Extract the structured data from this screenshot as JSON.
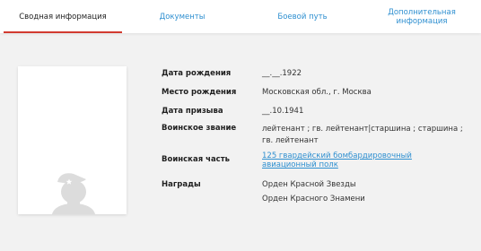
{
  "tabs": [
    {
      "label": "Сводная информация",
      "active": true
    },
    {
      "label": "Документы",
      "active": false
    },
    {
      "label": "Боевой путь",
      "active": false
    },
    {
      "label": "Дополнительная информация",
      "active": false
    }
  ],
  "colors": {
    "accent_red": "#d23b30",
    "link_blue": "#2e8fd0",
    "background": "#f2f2f2",
    "avatar_gray": "#dcdcdc"
  },
  "icons": {
    "avatar": "soldier-silhouette-icon"
  },
  "profile": {
    "birth_date": {
      "label": "Дата рождения",
      "value": "__.__.1922"
    },
    "birth_place": {
      "label": "Место рождения",
      "value": "Московская обл., г. Москва"
    },
    "draft_date": {
      "label": "Дата призыва",
      "value": "__.10.1941"
    },
    "rank": {
      "label": "Воинское звание",
      "value": "лейтенант ; гв. лейтенант|старшина ; старшина ; гв. лейтенант"
    },
    "unit": {
      "label": "Воинская часть",
      "value": "125 гвардейский бомбардировочный авиационный полк"
    },
    "awards": {
      "label": "Награды",
      "values": [
        "Орден Красной Звезды",
        "Орден Красного Знамени"
      ]
    }
  }
}
